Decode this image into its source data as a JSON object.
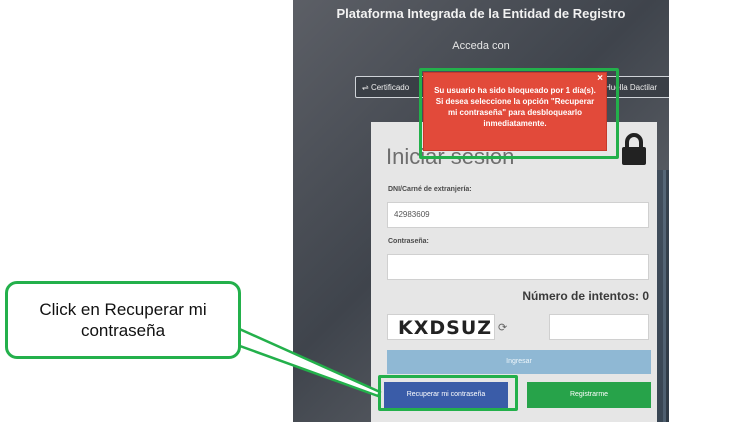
{
  "header": {
    "title": "Plataforma Integrada de la Entidad de Registro",
    "subtitle": "Acceda con"
  },
  "auth_options": {
    "certificate_label": "Certificado",
    "fingerprint_label": "Huella Dactilar"
  },
  "login": {
    "title": "Iniciar sesión",
    "dni_label": "DNI/Carné de extranjería:",
    "dni_value": "42983609",
    "password_label": "Contraseña:",
    "attempts_text": "Número de intentos: 0",
    "captcha_text": "KXDSUZ",
    "refresh_glyph": "⟳",
    "ingresar_label": "Ingresar",
    "recuperar_label": "Recuperar mi contraseña",
    "registrarme_label": "Registrarme"
  },
  "popup": {
    "message": "Su usuario ha sido bloqueado por 1 día(s). Si desea seleccione la opción \"Recuperar mi contraseña\" para desbloquearlo inmediatamente.",
    "close_glyph": "×"
  },
  "annotation": {
    "callout_text": "Click en Recuperar mi contraseña",
    "highlight_color": "#23b04b"
  },
  "colors": {
    "error_red": "#e24a3a",
    "recover_blue": "#3a5ca8",
    "register_green": "#27a34a",
    "ingresar_light_blue": "#8fb8d4"
  }
}
